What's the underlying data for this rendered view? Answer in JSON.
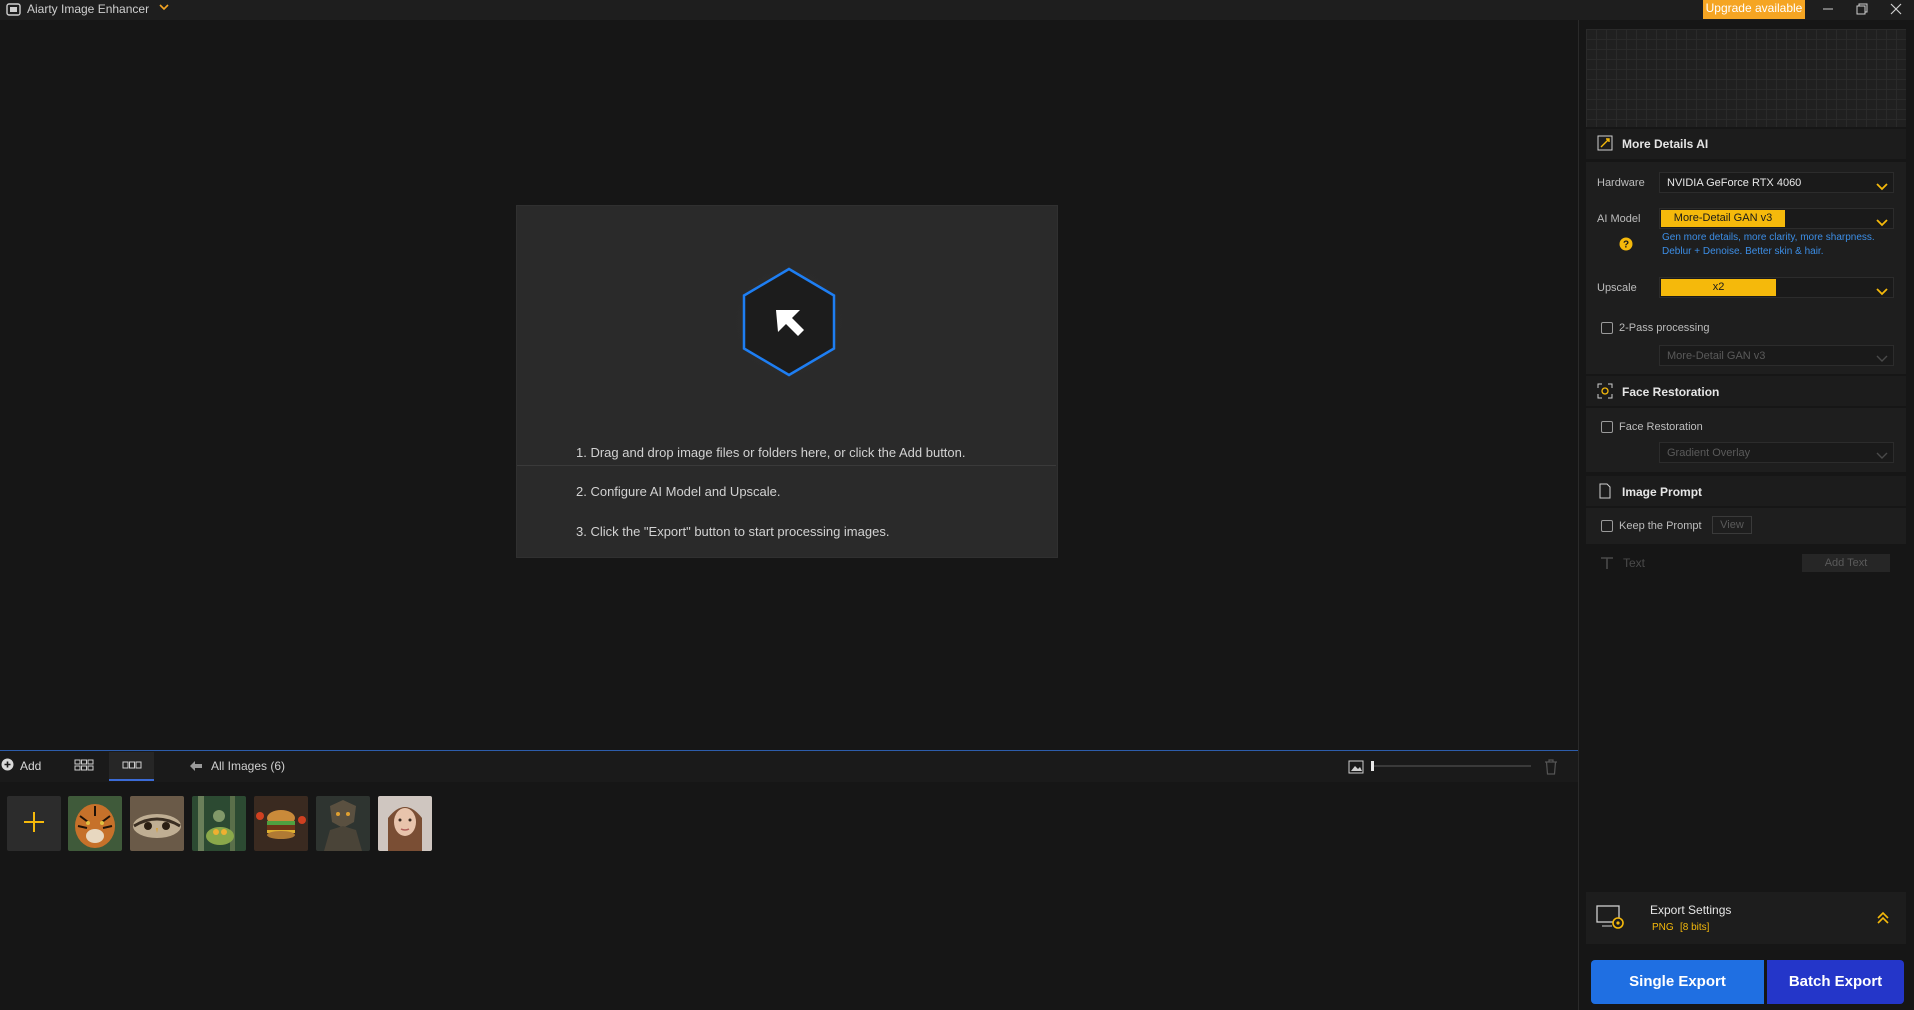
{
  "titlebar": {
    "app_title": "Aiarty Image Enhancer",
    "upgrade_label": "Upgrade available"
  },
  "welcome": {
    "steps": [
      "1. Drag and drop image files or folders here, or click the Add button.",
      "2. Configure AI Model and Upscale.",
      "3. Click the \"Export\" button to start processing images."
    ]
  },
  "filmstrip": {
    "add_label": "Add",
    "all_images_label": "All Images (6)",
    "thumbnails": [
      "tiger",
      "owl",
      "forest-frog",
      "burger",
      "armored-figure",
      "woman-portrait"
    ]
  },
  "panel": {
    "more_details": {
      "title": "More Details AI",
      "hardware_label": "Hardware",
      "hardware_value": "NVIDIA GeForce RTX 4060",
      "ai_model_label": "AI Model",
      "ai_model_value": "More-Detail GAN  v3",
      "ai_model_desc_1": "Gen more details, more clarity, more sharpness.",
      "ai_model_desc_2": "Deblur + Denoise. Better skin & hair.",
      "upscale_label": "Upscale",
      "upscale_value": "x2",
      "two_pass_label": "2-Pass processing",
      "two_pass_model": "More-Detail GAN  v3"
    },
    "face_restoration": {
      "title": "Face Restoration",
      "checkbox_label": "Face Restoration",
      "mode_value": "Gradient Overlay"
    },
    "image_prompt": {
      "title": "Image Prompt",
      "keep_label": "Keep the Prompt",
      "view_label": "View"
    },
    "text_section": {
      "label": "Text",
      "add_text_label": "Add Text"
    },
    "export": {
      "title": "Export Settings",
      "format": "PNG",
      "bits": "[8 bits]",
      "single_label": "Single Export",
      "batch_label": "Batch Export"
    }
  },
  "colors": {
    "accent_orange": "#f5a523",
    "accent_yellow": "#f5b90b",
    "single_export_blue": "#1f6fe2",
    "batch_export_blue": "#2436c9",
    "hex_blue": "#1e7ef2"
  }
}
